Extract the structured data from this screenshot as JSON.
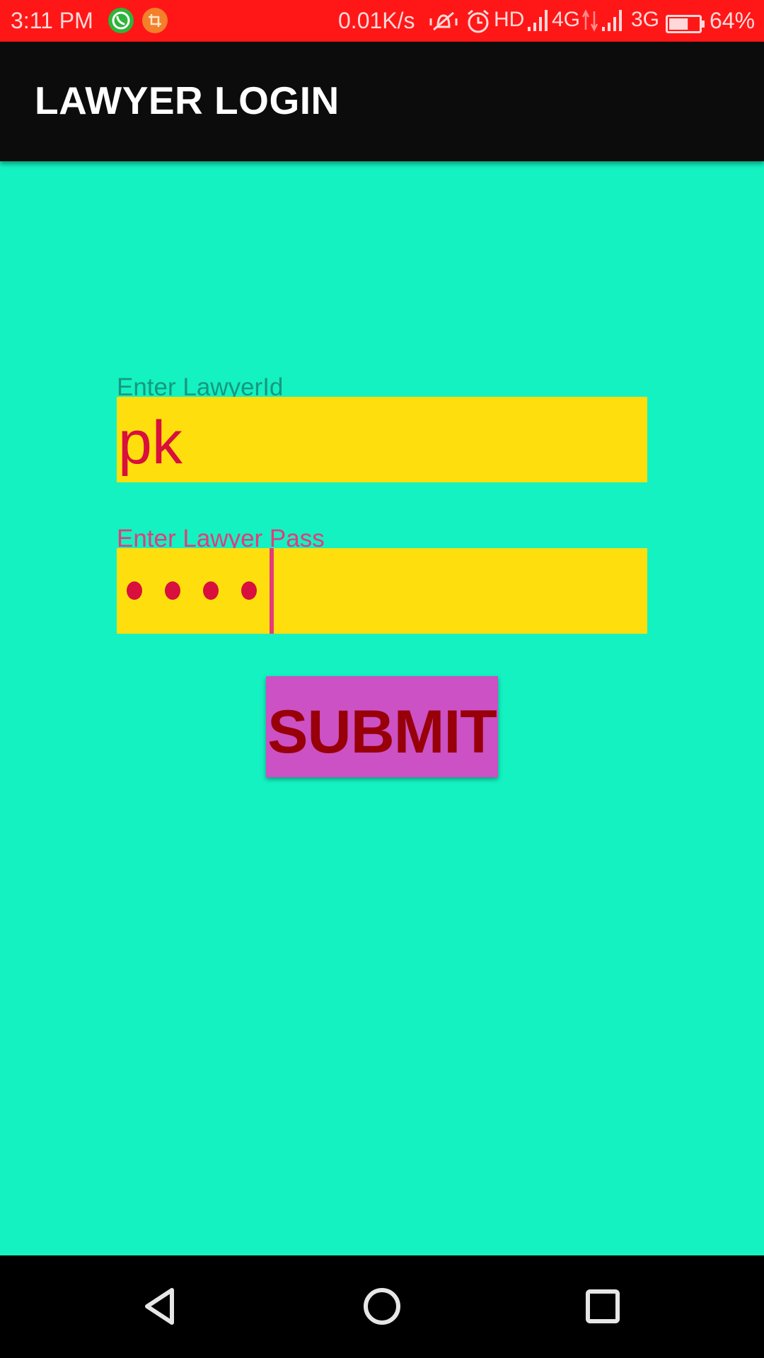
{
  "status_bar": {
    "time": "3:11 PM",
    "network_speed": "0.01K/s",
    "hd_label": "HD",
    "network_4g": "4G",
    "network_3g": "3G",
    "battery_percent": "64%",
    "battery_level": 0.64,
    "icons": [
      "whatsapp-icon",
      "crop-icon",
      "vibrate-icon",
      "alarm-icon",
      "signal-icon",
      "data-arrows-icon",
      "battery-icon"
    ]
  },
  "app_bar": {
    "title": "LAWYER LOGIN"
  },
  "form": {
    "lawyer_id": {
      "label": "Enter LawyerId",
      "value": "pk"
    },
    "lawyer_pass": {
      "label": "Enter Lawyer Pass",
      "masked_length": 4
    },
    "submit_label": "SUBMIT"
  },
  "nav_bar": {
    "buttons": [
      "back-icon",
      "home-icon",
      "recents-icon"
    ]
  },
  "colors": {
    "status_bar": "#ff1717",
    "app_bar": "#0c0c0c",
    "background": "#14f2c1",
    "input_background": "#fedf0d",
    "input_text": "#d90f3d",
    "label_id": "#17987e",
    "label_pass": "#e33c7a",
    "button_background": "#cb51c4",
    "button_text": "#980009"
  }
}
